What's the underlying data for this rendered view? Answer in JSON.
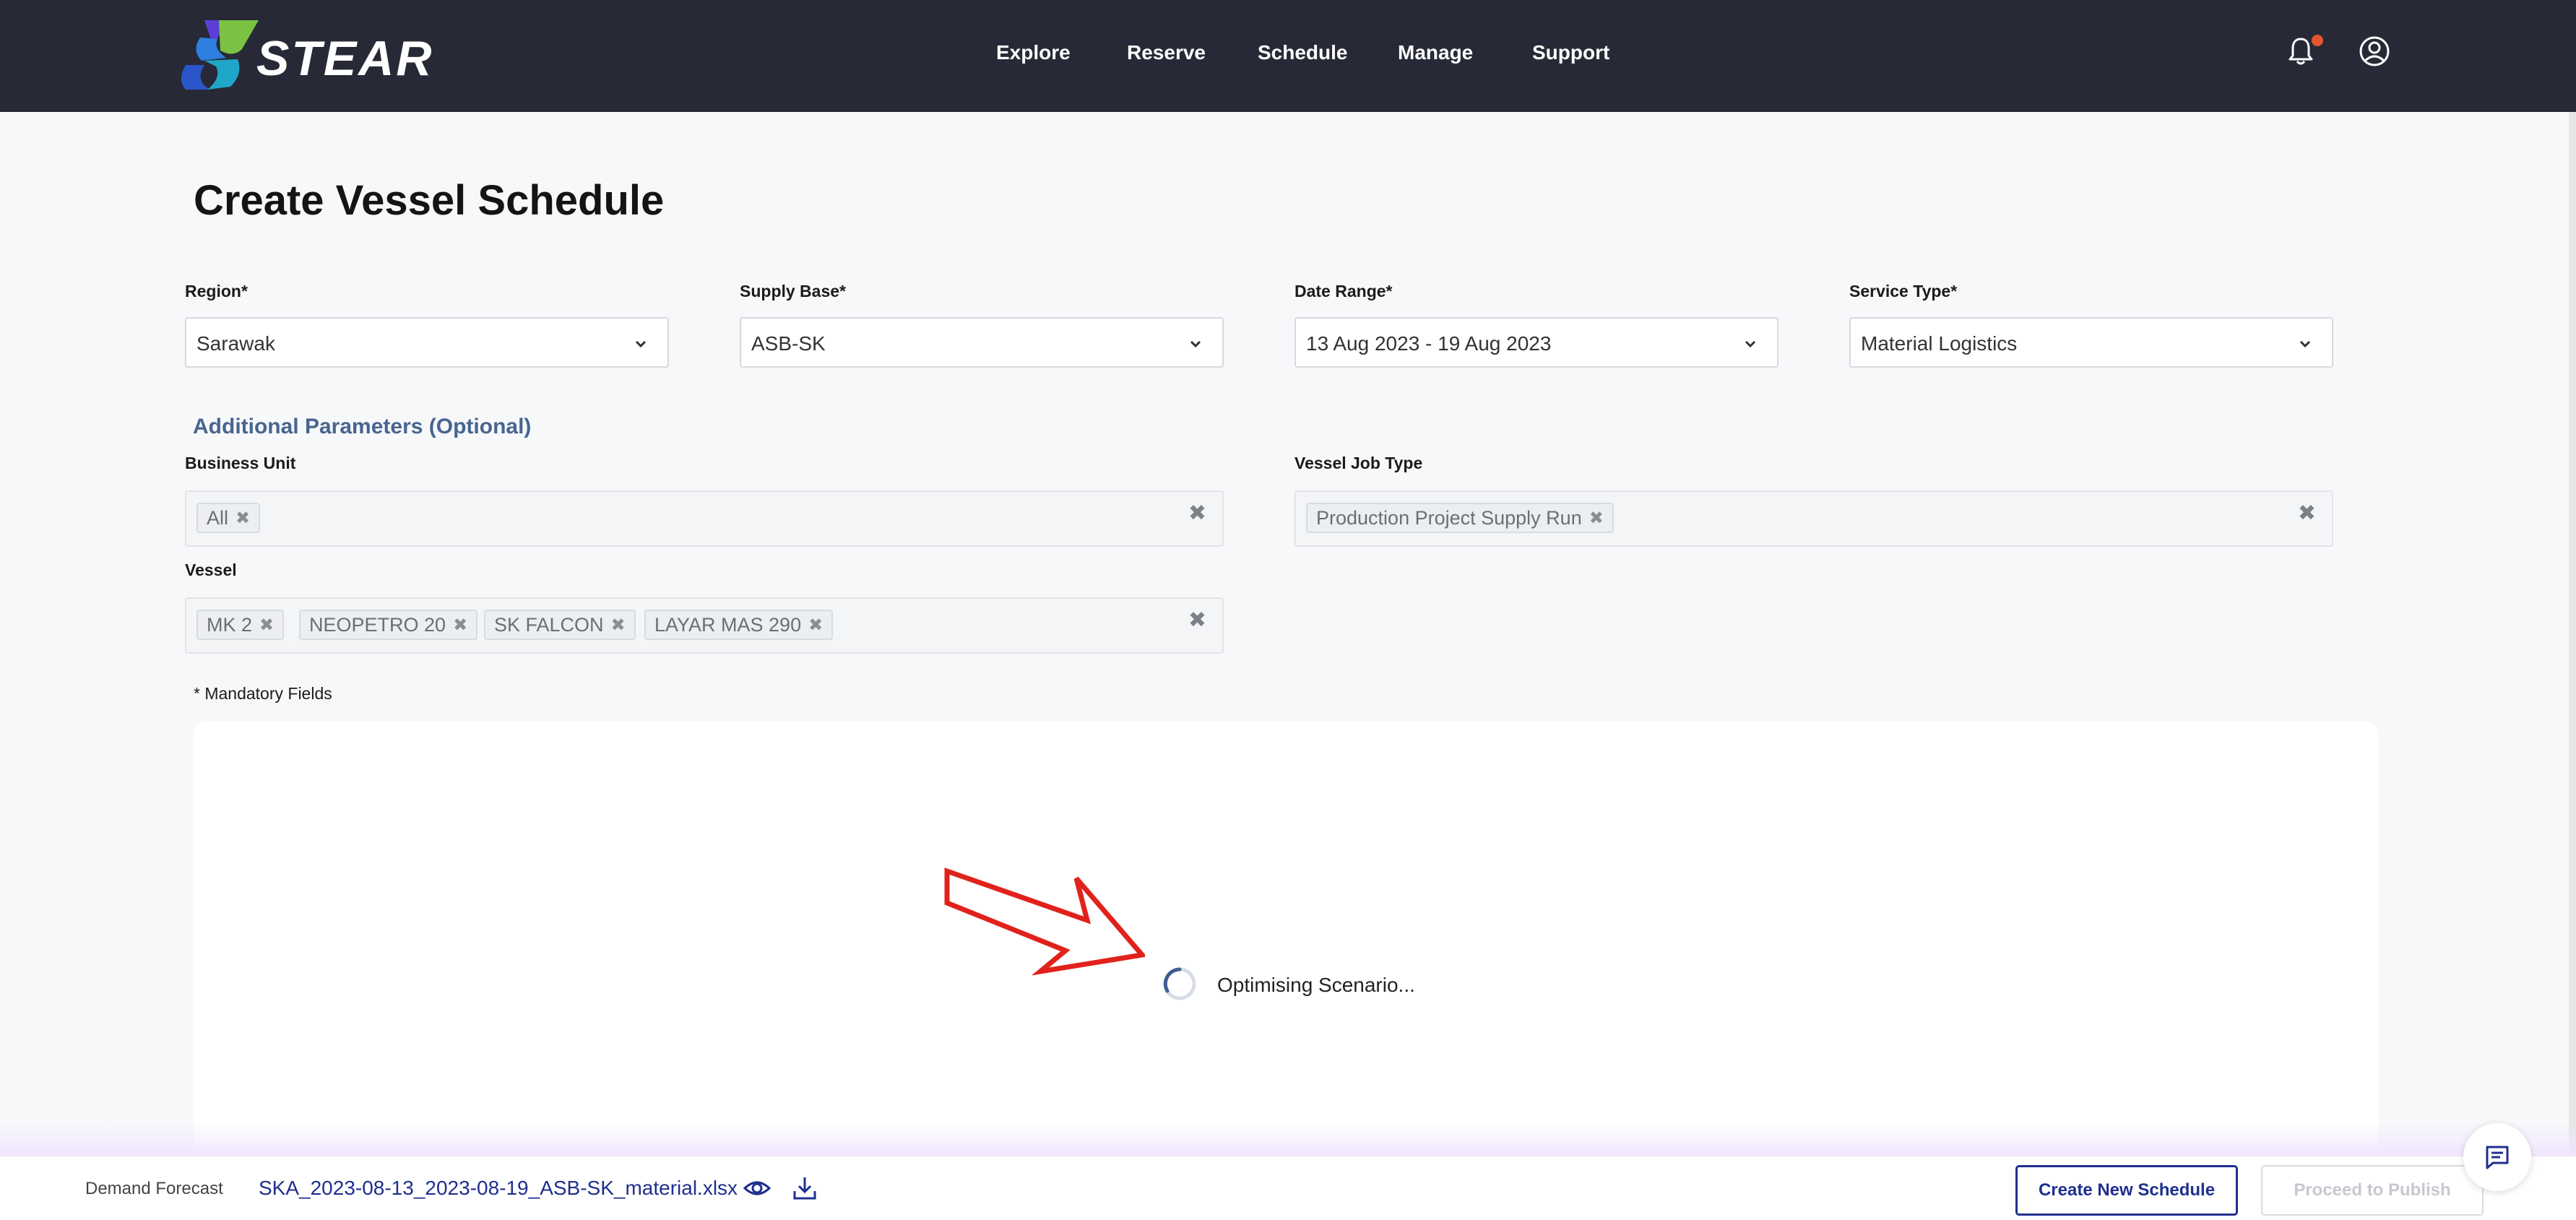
{
  "nav": {
    "logo_text": "STEAR",
    "items": [
      "Explore",
      "Reserve",
      "Schedule",
      "Manage",
      "Support"
    ],
    "icons": [
      "bell-icon",
      "user-account-icon"
    ]
  },
  "page": {
    "title": "Create Vessel Schedule"
  },
  "form": {
    "region": {
      "label": "Region*",
      "value": "Sarawak"
    },
    "supply_base": {
      "label": "Supply Base*",
      "value": "ASB-SK"
    },
    "date_range": {
      "label": "Date Range*",
      "value": "13 Aug 2023 - 19 Aug 2023"
    },
    "service_type": {
      "label": "Service Type*",
      "value": "Material Logistics"
    },
    "additional_title": "Additional Parameters (Optional)",
    "business_unit": {
      "label": "Business Unit",
      "chips": [
        "All"
      ]
    },
    "vessel_job_type": {
      "label": "Vessel Job Type",
      "chips": [
        "Production Project Supply Run"
      ]
    },
    "vessel": {
      "label": "Vessel",
      "chips": [
        "MK 2",
        "NEOPETRO 20",
        "SK FALCON",
        "LAYAR MAS 290"
      ]
    },
    "mandatory_note": "* Mandatory Fields"
  },
  "status": {
    "text": "Optimising Scenario..."
  },
  "bottom": {
    "label": "Demand Forecast",
    "file": "SKA_2023-08-13_2023-08-19_ASB-SK_material.xlsx",
    "create_button": "Create New Schedule",
    "publish_button": "Proceed to Publish"
  },
  "colors": {
    "navbar": "#272a36",
    "accent": "#1f2f8f",
    "section_title": "#47658f",
    "arrow": "#e0221b"
  }
}
